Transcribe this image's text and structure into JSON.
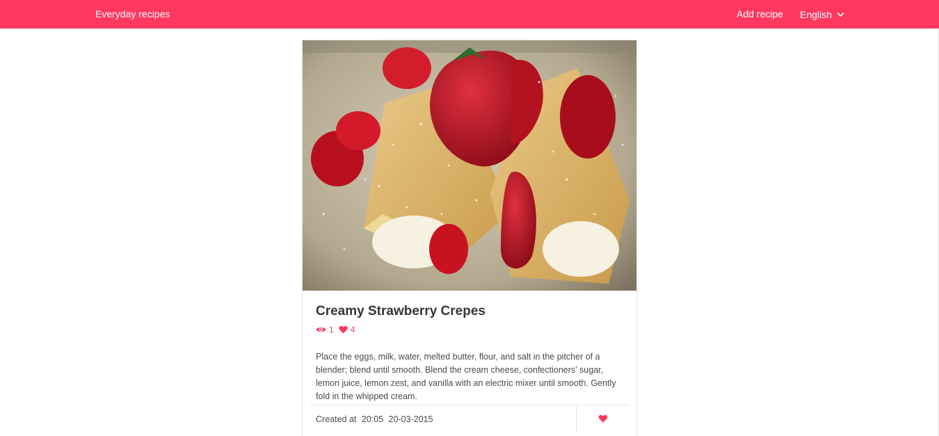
{
  "navbar": {
    "brand": "Everyday recipes",
    "add_recipe": "Add recipe",
    "language": "English"
  },
  "icons": {
    "views": "eye-icon",
    "likes": "heart-icon",
    "language_toggle": "chevron-down-icon",
    "like_action": "heart-icon"
  },
  "colors": {
    "accent": "#ff3860",
    "text": "#4a4a4a",
    "border": "#e3e3e3"
  },
  "recipe": {
    "title": "Creamy Strawberry Crepes",
    "views": "1",
    "likes": "4",
    "description": "Place the eggs, milk, water, melted butter, flour, and salt in the pitcher of a blender; blend until smooth. Blend the cream cheese, confectioners' sugar, lemon juice, lemon zest, and vanilla with an electric mixer until smooth. Gently fold in the whipped cream.",
    "created_label": "Created at",
    "created_time": "20:05",
    "created_date": "20-03-2015"
  }
}
